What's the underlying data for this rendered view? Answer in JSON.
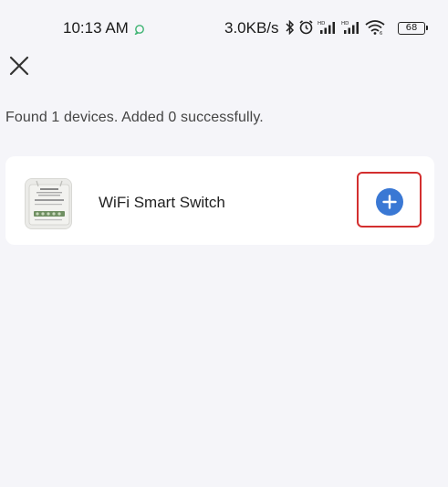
{
  "status_bar": {
    "time": "10:13 AM",
    "network_speed": "3.0KB/s",
    "battery_level": "68",
    "icons": [
      "message-bubble-icon",
      "bluetooth-icon",
      "alarm-icon",
      "hd-signal-icon",
      "hd-signal-icon",
      "wifi-icon",
      "battery-icon"
    ]
  },
  "header": {
    "close_icon": "close-icon"
  },
  "summary": {
    "text": "Found 1 devices. Added 0 successfully."
  },
  "devices": [
    {
      "name": "WiFi Smart Switch",
      "thumbnail": "smart-switch-module-image",
      "action_icon": "plus-icon"
    }
  ],
  "colors": {
    "background": "#f5f5f9",
    "card": "#ffffff",
    "accent": "#3a78d4",
    "highlight": "#d32f2f"
  }
}
